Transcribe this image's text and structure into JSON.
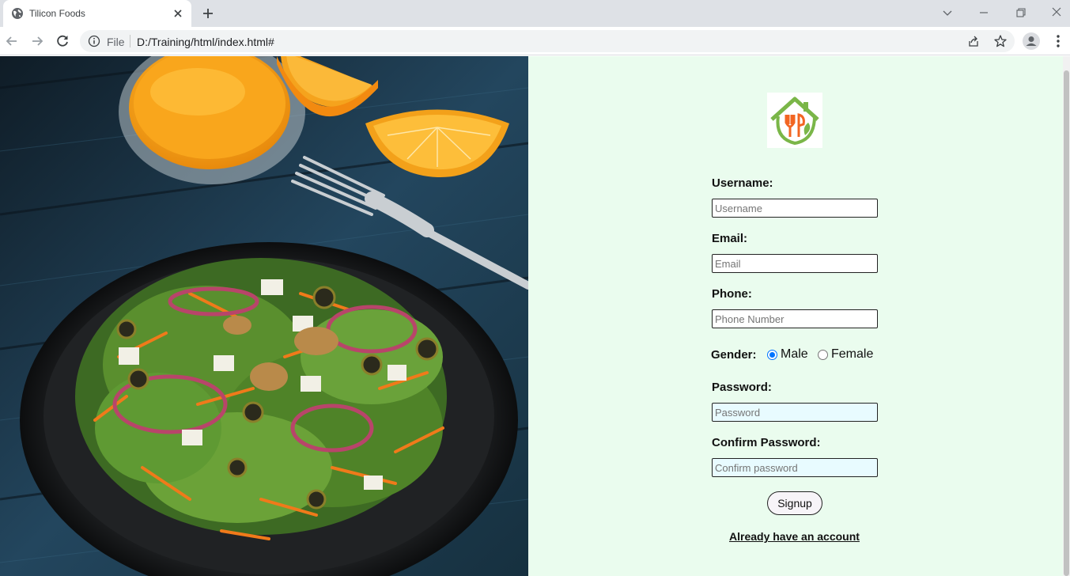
{
  "browser": {
    "tab_title": "Tilicon Foods",
    "scheme_label": "File",
    "url": "D:/Training/html/index.html#"
  },
  "form": {
    "username_label": "Username:",
    "username_placeholder": "Username",
    "email_label": "Email:",
    "email_placeholder": "Email",
    "phone_label": "Phone:",
    "phone_placeholder": "Phone Number",
    "gender_label": "Gender:",
    "gender_options": [
      "Male",
      "Female"
    ],
    "gender_selected": "Male",
    "password_label": "Password:",
    "password_placeholder": "Password",
    "confirm_label": "Confirm Password:",
    "confirm_placeholder": "Confirm password",
    "signup_label": "Signup",
    "login_link": "Already have an account"
  },
  "colors": {
    "panel_bg": "#eafcee",
    "logo_green": "#7ab648",
    "logo_orange": "#f26522",
    "radio_accent": "#0075ff"
  }
}
